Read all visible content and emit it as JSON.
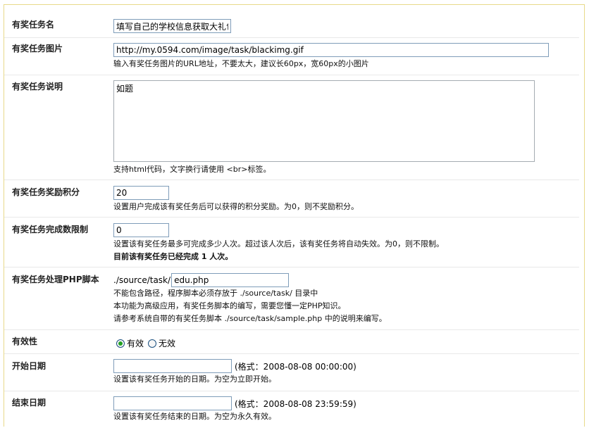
{
  "fields": {
    "name": {
      "label": "有奖任务名",
      "value": "填写自己的学校信息获取大礼包"
    },
    "image": {
      "label": "有奖任务图片",
      "value": "http://my.0594.com/image/task/blackimg.gif",
      "hint": "输入有奖任务图片的URL地址，不要太大，建议长60px，宽60px的小图片"
    },
    "description": {
      "label": "有奖任务说明",
      "value": "如题",
      "hint": "支持html代码，文字换行请使用 <br>标签。"
    },
    "reward": {
      "label": "有奖任务奖励积分",
      "value": "20",
      "hint": "设置用户完成该有奖任务后可以获得的积分奖励。为0，则不奖励积分。"
    },
    "limit": {
      "label": "有奖任务完成数限制",
      "value": "0",
      "hint": "设置该有奖任务最多可完成多少人次。超过该人次后，该有奖任务将自动失效。为0，则不限制。",
      "status": "目前该有奖任务已经完成  1 人次。"
    },
    "script": {
      "label": "有奖任务处理PHP脚本",
      "prefix": "./source/task/",
      "value": "edu.php",
      "hint1": "不能包含路径，程序脚本必须存放于  ./source/task/ 目录中",
      "hint2": "本功能为高级应用，有奖任务脚本的编写，需要您懂一定PHP知识。",
      "hint3": "请参考系统自带的有奖任务脚本 ./source/task/sample.php 中的说明来编写。"
    },
    "validity": {
      "label": "有效性",
      "options": [
        "有效",
        "无效"
      ],
      "selected": "有效"
    },
    "start": {
      "label": "开始日期",
      "value": "",
      "format": "(格式：2008-08-08 00:00:00)",
      "hint": "设置该有奖任务开始的日期。为空为立即开始。"
    },
    "end": {
      "label": "结束日期",
      "value": "",
      "format": "(格式：2008-08-08 23:59:59)",
      "hint": "设置该有奖任务结束的日期。为空为永久有效。"
    }
  },
  "colors": {
    "border": "#e8d98a",
    "input_border": "#7f9db9",
    "radio_check": "#21a121"
  }
}
